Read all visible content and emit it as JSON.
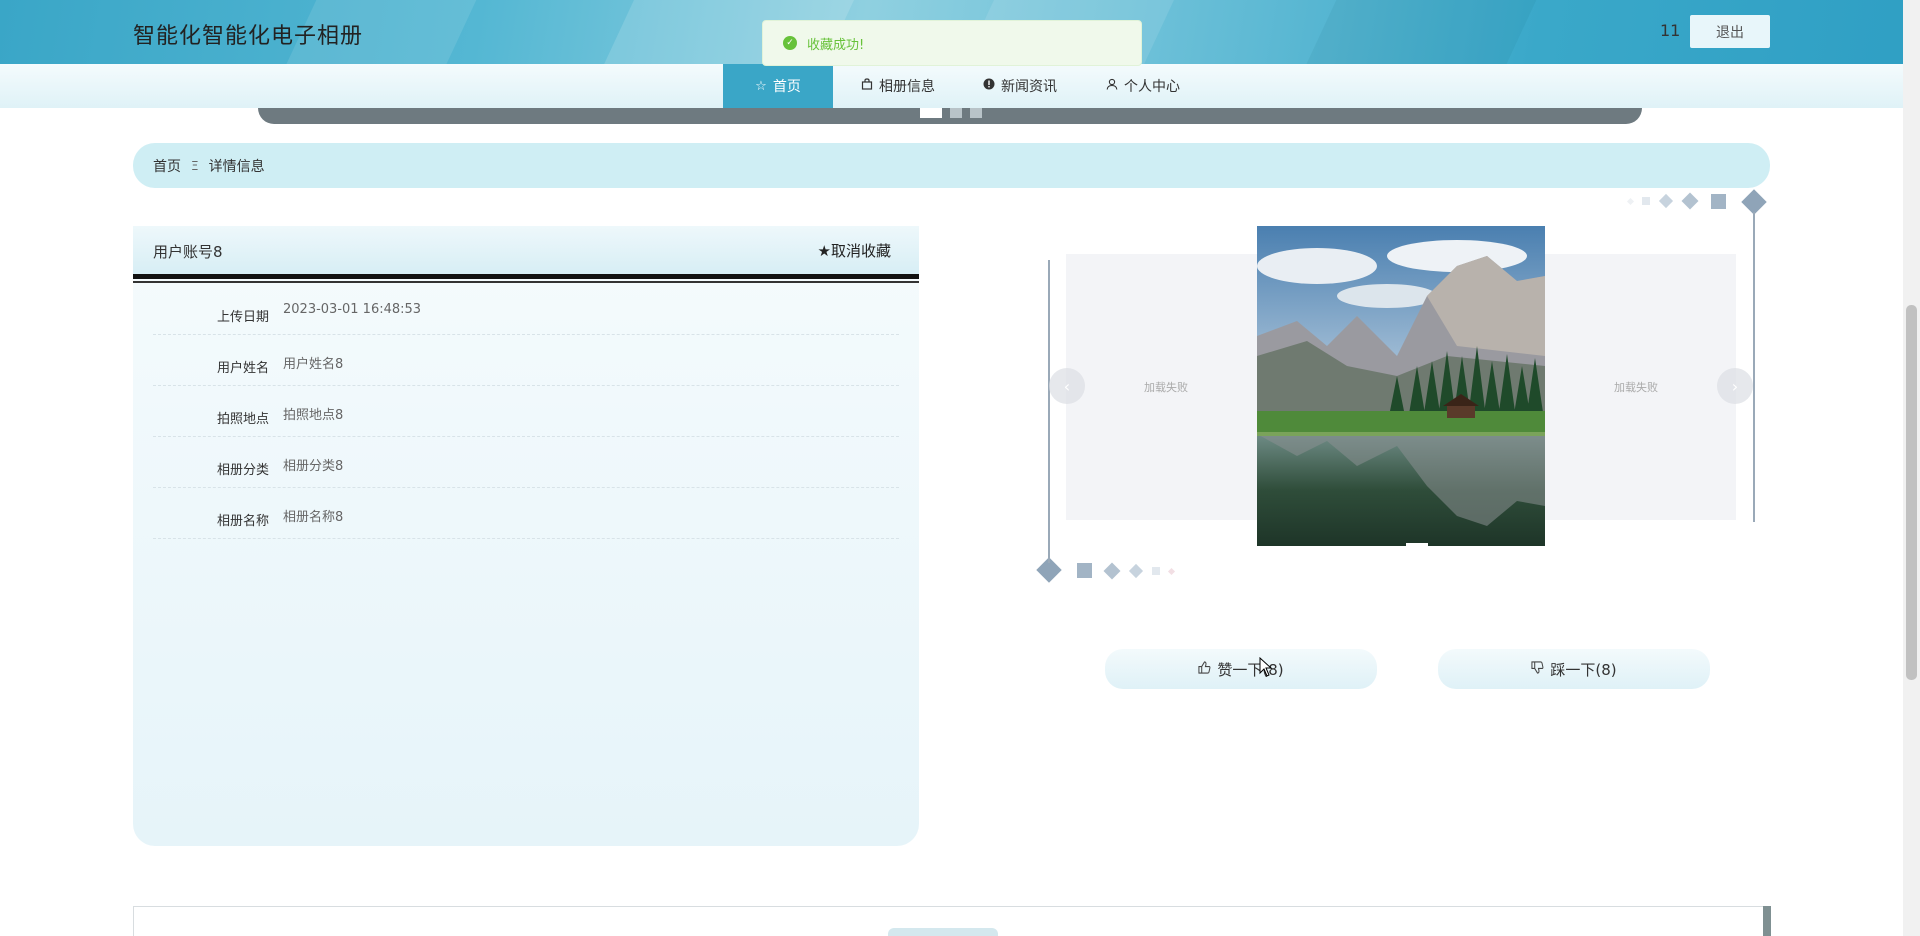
{
  "header": {
    "site_title": "智能化智能化电子相册",
    "user_name": "11",
    "logout_label": "退出"
  },
  "nav": {
    "items": [
      {
        "label": "首页",
        "icon": "star-icon",
        "active": true
      },
      {
        "label": "相册信息",
        "icon": "bag-icon",
        "active": false
      },
      {
        "label": "新闻资讯",
        "icon": "info-icon",
        "active": false
      },
      {
        "label": "个人中心",
        "icon": "user-icon",
        "active": false
      }
    ]
  },
  "toast": {
    "message": "收藏成功!",
    "type": "success",
    "color": "#67c23a"
  },
  "breadcrumb": {
    "home": "首页",
    "separator": "Ξ",
    "current": "详情信息"
  },
  "detail": {
    "account": "用户账号8",
    "favorite_label": "★取消收藏",
    "fields": [
      {
        "label": "上传日期",
        "value": "2023-03-01 16:48:53"
      },
      {
        "label": "用户姓名",
        "value": "用户姓名8"
      },
      {
        "label": "拍照地点",
        "value": "拍照地点8"
      },
      {
        "label": "相册分类",
        "value": "相册分类8"
      },
      {
        "label": "相册名称",
        "value": "相册名称8"
      }
    ]
  },
  "gallery": {
    "left_placeholder": "加载失败",
    "right_placeholder": "加载失败",
    "prev_icon": "chevron-left-icon",
    "next_icon": "chevron-right-icon"
  },
  "votes": {
    "like_label": "赞一下(8)",
    "dislike_label": "踩一下(8)"
  },
  "colors": {
    "header": "#3aa6c7",
    "nav_active": "#3aa6c7",
    "breadcrumb_bg": "#cfeef4",
    "deco": "#8fa4b8"
  }
}
